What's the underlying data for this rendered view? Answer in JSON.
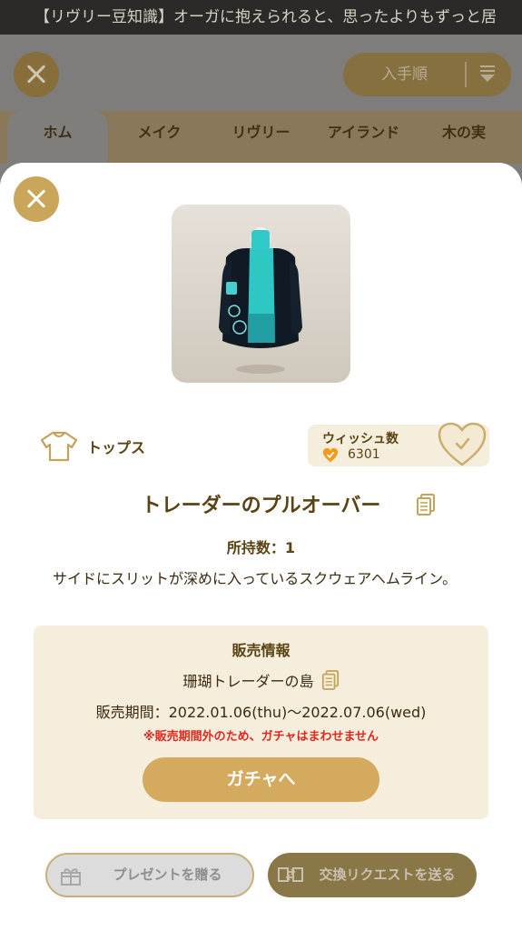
{
  "ticker": {
    "text": "【リヴリー豆知識】オーガに抱えられると、思ったよりもずっと居"
  },
  "background": {
    "sort_label": "入手順",
    "tabs": [
      {
        "label": "ホム",
        "active": true
      },
      {
        "label": "メイク",
        "active": false
      },
      {
        "label": "リヴリー",
        "active": false
      },
      {
        "label": "アイランド",
        "active": false
      },
      {
        "label": "木の実",
        "active": false
      }
    ]
  },
  "item": {
    "category_icon": "shirt-icon",
    "category": "トップス",
    "wish_label": "ウィッシュ数",
    "wish_count": "6301",
    "name": "トレーダーのプルオーバー",
    "owned": "所持数：1",
    "description": "サイドにスリットが深めに入っているスクウェアヘムライン。"
  },
  "sale": {
    "title": "販売情報",
    "place": "珊瑚トレーダーの島",
    "period": "販売期間：2022.01.06(thu)〜2022.07.06(wed)",
    "warning": "※販売期間外のため、ガチャはまわせません",
    "gacha_button": "ガチャへ"
  },
  "actions": {
    "present": "プレゼントを贈る",
    "trade": "交換リクエストを送る"
  },
  "colors": {
    "accent": "#d4ab5e",
    "text": "#5a4312",
    "panel": "#f6eedd",
    "warning": "#e5261d"
  }
}
